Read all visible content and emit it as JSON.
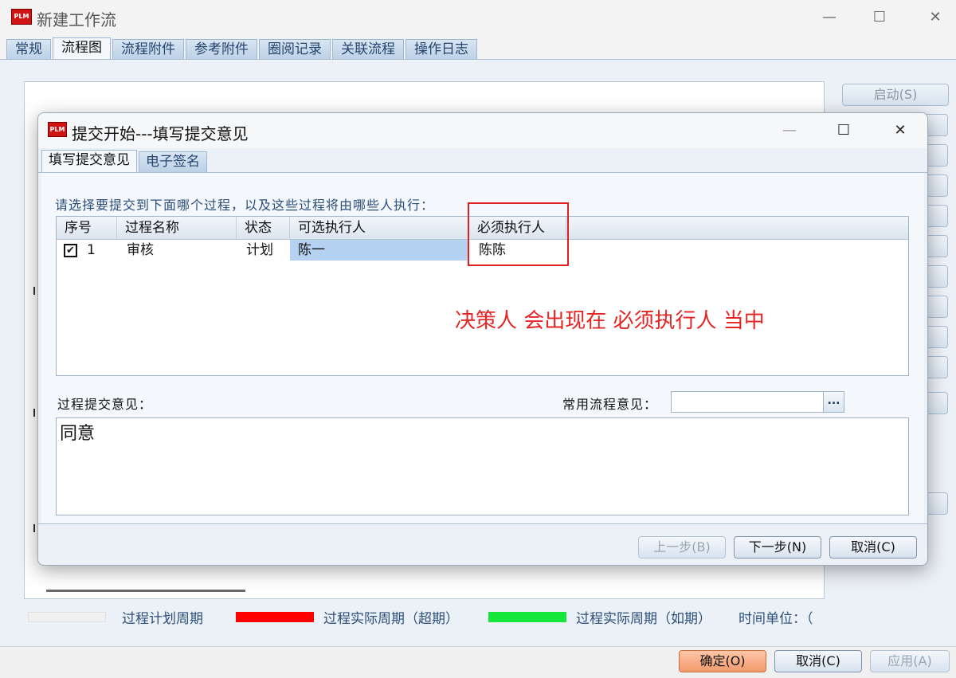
{
  "window": {
    "logo_text": "PLM",
    "title": "新建工作流",
    "minimize": "—",
    "maximize": "☐",
    "close": "✕",
    "tabs": [
      "常规",
      "流程图",
      "流程附件",
      "参考附件",
      "圈阅记录",
      "关联流程",
      "操作日志"
    ],
    "active_tab": "流程图"
  },
  "side_buttons": {
    "start": "启动(S)"
  },
  "legend": {
    "items": [
      {
        "label": "过程计划周期",
        "color": "#f0f0f0"
      },
      {
        "label": "过程实际周期（超期）",
        "color": "#ff0000"
      },
      {
        "label": "过程实际周期（如期）",
        "color": "#14e63c"
      }
    ],
    "time_unit_label": "时间单位：（"
  },
  "footer": {
    "ok": "确定(O)",
    "cancel": "取消(C)",
    "apply": "应用(A)"
  },
  "dialog": {
    "logo_text": "PLM",
    "title": "提交开始---填写提交意见",
    "minimize": "—",
    "maximize": "☐",
    "close": "✕",
    "tabs": [
      "填写提交意见",
      "电子签名"
    ],
    "active_tab": "填写提交意见",
    "instruction": "请选择要提交到下面哪个过程，以及这些过程将由哪些人执行：",
    "table": {
      "columns": [
        "序号",
        "过程名称",
        "状态",
        "可选执行人",
        "必须执行人"
      ],
      "rows": [
        {
          "checked": true,
          "seq": "1",
          "name": "审核",
          "status": "计划",
          "optional": "陈一",
          "required": "陈陈"
        }
      ]
    },
    "annotation": "决策人 会出现在 必须执行人 当中",
    "opinion_label": "过程提交意见：",
    "common_opinion_label": "常用流程意见：",
    "common_opinion_value": "",
    "ellipsis": "...",
    "opinion_text": "同意",
    "buttons": {
      "prev": "上一步(B)",
      "next": "下一步(N)",
      "cancel": "取消(C)"
    }
  }
}
